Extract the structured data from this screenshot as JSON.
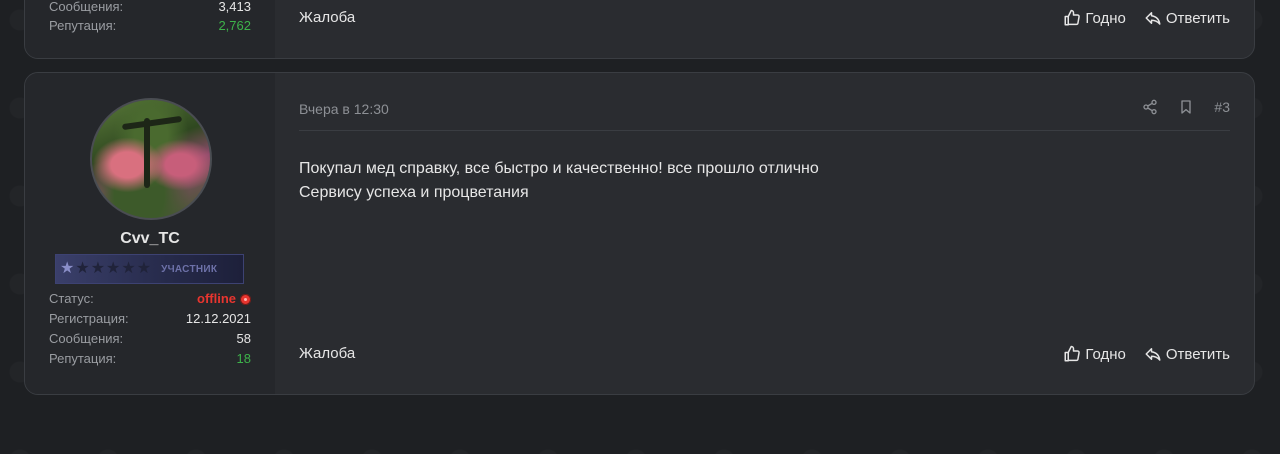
{
  "previous_post": {
    "stats": [
      {
        "label": "Сообщения:",
        "value": "3,413"
      },
      {
        "label": "Репутация:",
        "value": "2,762"
      }
    ],
    "report_label": "Жалоба",
    "like_label": "Годно",
    "reply_label": "Ответить"
  },
  "post": {
    "author": {
      "username": "Cvv_TC",
      "rank_label": "УЧАСТНИК",
      "rank_stars_filled": 1,
      "rank_stars_total": 6,
      "stats": {
        "status_label": "Статус:",
        "status_value": "offline",
        "reg_label": "Регистрация:",
        "reg_value": "12.12.2021",
        "msg_label": "Сообщения:",
        "msg_value": "58",
        "rep_label": "Репутация:",
        "rep_value": "18"
      }
    },
    "timestamp": "Вчера в 12:30",
    "post_number": "#3",
    "message_lines": [
      "Покупал мед справку, все быстро и качественно! все прошло отлично",
      "Сервису успеха и процветания"
    ],
    "report_label": "Жалоба",
    "like_label": "Годно",
    "reply_label": "Ответить"
  },
  "colors": {
    "background": "#1e2023",
    "card": "#2a2c30",
    "sidebar": "#25272b",
    "positive": "#3db24a",
    "offline": "#e8352f"
  }
}
